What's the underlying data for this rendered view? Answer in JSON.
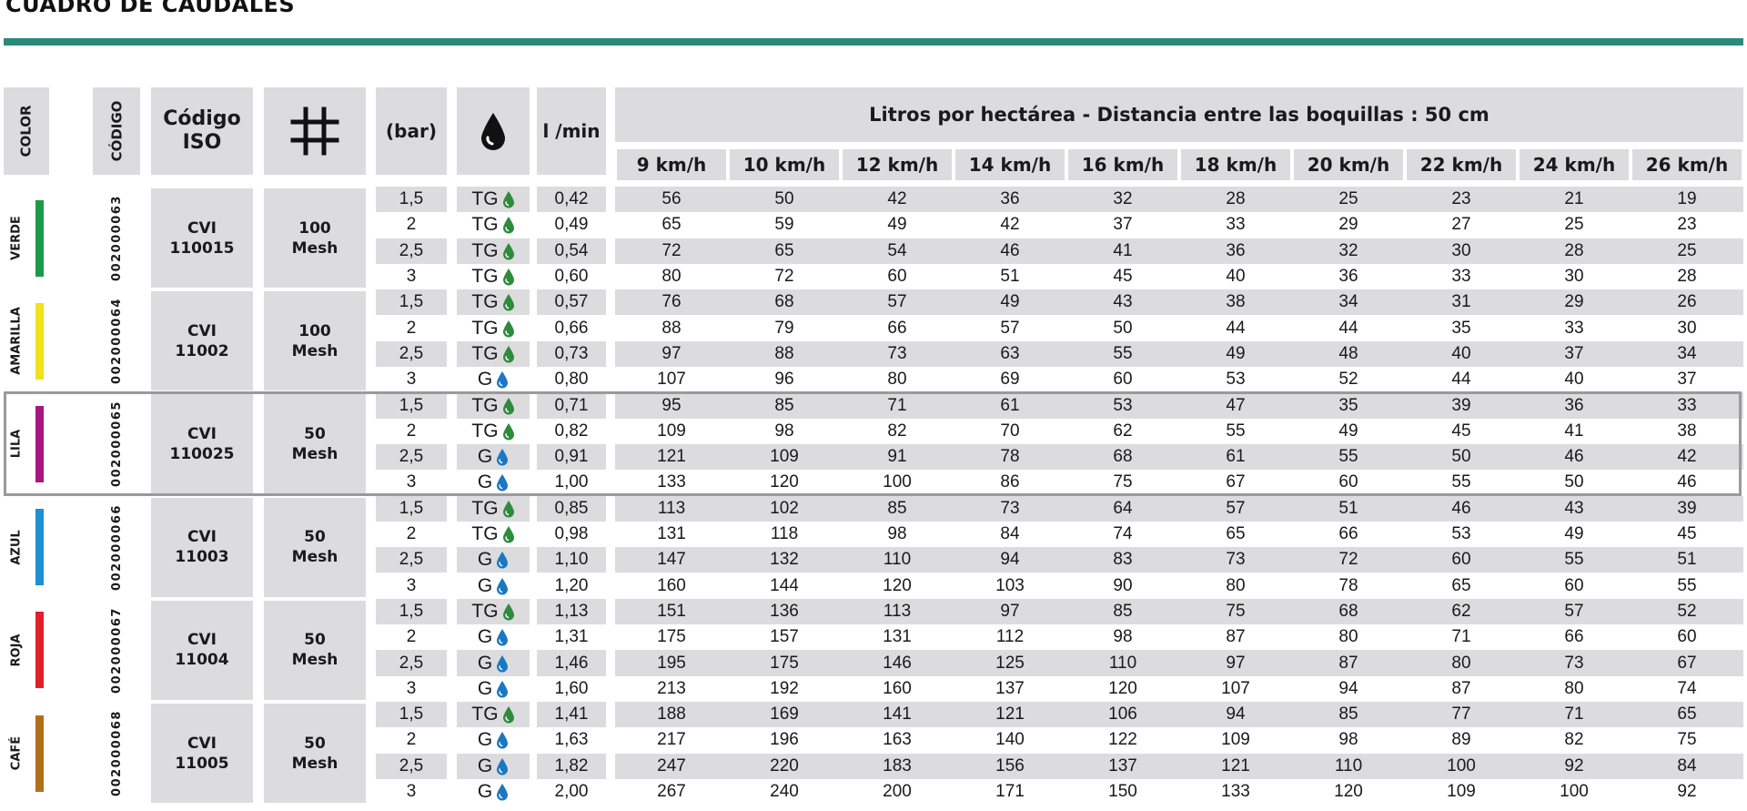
{
  "title": "CUADRO DE CAUDALES",
  "header": {
    "color": "COLOR",
    "codigo": "CÓDIGO",
    "iso": "Código ISO",
    "bar": "(bar)",
    "lmin": "l /min",
    "span": "Litros por hectárea - Distancia entre las boquillas : 50 cm",
    "speeds": [
      "9 km/h",
      "10 km/h",
      "12 km/h",
      "14 km/h",
      "16 km/h",
      "18 km/h",
      "20 km/h",
      "22 km/h",
      "24 km/h",
      "26 km/h"
    ]
  },
  "colors": {
    "TG": "#2e8b3c",
    "G": "#1a78c2",
    "accent": "#2a8a7a"
  },
  "groups": [
    {
      "color": "VERDE",
      "swatch": "#1a9a4a",
      "code": "002000063",
      "iso1": "CVI",
      "iso2": "110015",
      "mesh1": "100",
      "mesh2": "Mesh",
      "rows": [
        {
          "bar": "1,5",
          "type": "TG",
          "lmin": "0,42",
          "vals": [
            "56",
            "50",
            "42",
            "36",
            "32",
            "28",
            "25",
            "23",
            "21",
            "19"
          ]
        },
        {
          "bar": "2",
          "type": "TG",
          "lmin": "0,49",
          "vals": [
            "65",
            "59",
            "49",
            "42",
            "37",
            "33",
            "29",
            "27",
            "25",
            "23"
          ]
        },
        {
          "bar": "2,5",
          "type": "TG",
          "lmin": "0,54",
          "vals": [
            "72",
            "65",
            "54",
            "46",
            "41",
            "36",
            "32",
            "30",
            "28",
            "25"
          ]
        },
        {
          "bar": "3",
          "type": "TG",
          "lmin": "0,60",
          "vals": [
            "80",
            "72",
            "60",
            "51",
            "45",
            "40",
            "36",
            "33",
            "30",
            "28"
          ]
        }
      ]
    },
    {
      "color": "AMARILLA",
      "swatch": "#f2e21a",
      "code": "002000064",
      "iso1": "CVI",
      "iso2": "11002",
      "mesh1": "100",
      "mesh2": "Mesh",
      "rows": [
        {
          "bar": "1,5",
          "type": "TG",
          "lmin": "0,57",
          "vals": [
            "76",
            "68",
            "57",
            "49",
            "43",
            "38",
            "34",
            "31",
            "29",
            "26"
          ]
        },
        {
          "bar": "2",
          "type": "TG",
          "lmin": "0,66",
          "vals": [
            "88",
            "79",
            "66",
            "57",
            "50",
            "44",
            "44",
            "35",
            "33",
            "30"
          ]
        },
        {
          "bar": "2,5",
          "type": "TG",
          "lmin": "0,73",
          "vals": [
            "97",
            "88",
            "73",
            "63",
            "55",
            "49",
            "48",
            "40",
            "37",
            "34"
          ]
        },
        {
          "bar": "3",
          "type": "G",
          "lmin": "0,80",
          "vals": [
            "107",
            "96",
            "80",
            "69",
            "60",
            "53",
            "52",
            "44",
            "40",
            "37"
          ]
        }
      ]
    },
    {
      "color": "LILA",
      "swatch": "#a8177f",
      "code": "002000065",
      "iso1": "CVI",
      "iso2": "110025",
      "mesh1": "50",
      "mesh2": "Mesh",
      "rows": [
        {
          "bar": "1,5",
          "type": "TG",
          "lmin": "0,71",
          "vals": [
            "95",
            "85",
            "71",
            "61",
            "53",
            "47",
            "35",
            "39",
            "36",
            "33"
          ]
        },
        {
          "bar": "2",
          "type": "TG",
          "lmin": "0,82",
          "vals": [
            "109",
            "98",
            "82",
            "70",
            "62",
            "55",
            "49",
            "45",
            "41",
            "38"
          ]
        },
        {
          "bar": "2,5",
          "type": "G",
          "lmin": "0,91",
          "vals": [
            "121",
            "109",
            "91",
            "78",
            "68",
            "61",
            "55",
            "50",
            "46",
            "42"
          ]
        },
        {
          "bar": "3",
          "type": "G",
          "lmin": "1,00",
          "vals": [
            "133",
            "120",
            "100",
            "86",
            "75",
            "67",
            "60",
            "55",
            "50",
            "46"
          ]
        }
      ]
    },
    {
      "color": "AZUL",
      "swatch": "#1e8fd2",
      "code": "002000066",
      "iso1": "CVI",
      "iso2": "11003",
      "mesh1": "50",
      "mesh2": "Mesh",
      "rows": [
        {
          "bar": "1,5",
          "type": "TG",
          "lmin": "0,85",
          "vals": [
            "113",
            "102",
            "85",
            "73",
            "64",
            "57",
            "51",
            "46",
            "43",
            "39"
          ]
        },
        {
          "bar": "2",
          "type": "TG",
          "lmin": "0,98",
          "vals": [
            "131",
            "118",
            "98",
            "84",
            "74",
            "65",
            "66",
            "53",
            "49",
            "45"
          ]
        },
        {
          "bar": "2,5",
          "type": "G",
          "lmin": "1,10",
          "vals": [
            "147",
            "132",
            "110",
            "94",
            "83",
            "73",
            "72",
            "60",
            "55",
            "51"
          ]
        },
        {
          "bar": "3",
          "type": "G",
          "lmin": "1,20",
          "vals": [
            "160",
            "144",
            "120",
            "103",
            "90",
            "80",
            "78",
            "65",
            "60",
            "55"
          ]
        }
      ]
    },
    {
      "color": "ROJA",
      "swatch": "#e0202a",
      "code": "002000067",
      "iso1": "CVI",
      "iso2": "11004",
      "mesh1": "50",
      "mesh2": "Mesh",
      "rows": [
        {
          "bar": "1,5",
          "type": "TG",
          "lmin": "1,13",
          "vals": [
            "151",
            "136",
            "113",
            "97",
            "85",
            "75",
            "68",
            "62",
            "57",
            "52"
          ]
        },
        {
          "bar": "2",
          "type": "G",
          "lmin": "1,31",
          "vals": [
            "175",
            "157",
            "131",
            "112",
            "98",
            "87",
            "80",
            "71",
            "66",
            "60"
          ]
        },
        {
          "bar": "2,5",
          "type": "G",
          "lmin": "1,46",
          "vals": [
            "195",
            "175",
            "146",
            "125",
            "110",
            "97",
            "87",
            "80",
            "73",
            "67"
          ]
        },
        {
          "bar": "3",
          "type": "G",
          "lmin": "1,60",
          "vals": [
            "213",
            "192",
            "160",
            "137",
            "120",
            "107",
            "94",
            "87",
            "80",
            "74"
          ]
        }
      ]
    },
    {
      "color": "CAFÉ",
      "swatch": "#b0701a",
      "code": "002000068",
      "iso1": "CVI",
      "iso2": "11005",
      "mesh1": "50",
      "mesh2": "Mesh",
      "rows": [
        {
          "bar": "1,5",
          "type": "TG",
          "lmin": "1,41",
          "vals": [
            "188",
            "169",
            "141",
            "121",
            "106",
            "94",
            "85",
            "77",
            "71",
            "65"
          ]
        },
        {
          "bar": "2",
          "type": "G",
          "lmin": "1,63",
          "vals": [
            "217",
            "196",
            "163",
            "140",
            "122",
            "109",
            "98",
            "89",
            "82",
            "75"
          ]
        },
        {
          "bar": "2,5",
          "type": "G",
          "lmin": "1,82",
          "vals": [
            "247",
            "220",
            "183",
            "156",
            "137",
            "121",
            "110",
            "100",
            "92",
            "84"
          ]
        },
        {
          "bar": "3",
          "type": "G",
          "lmin": "2,00",
          "vals": [
            "267",
            "240",
            "200",
            "171",
            "150",
            "133",
            "120",
            "109",
            "100",
            "92"
          ]
        }
      ]
    }
  ]
}
